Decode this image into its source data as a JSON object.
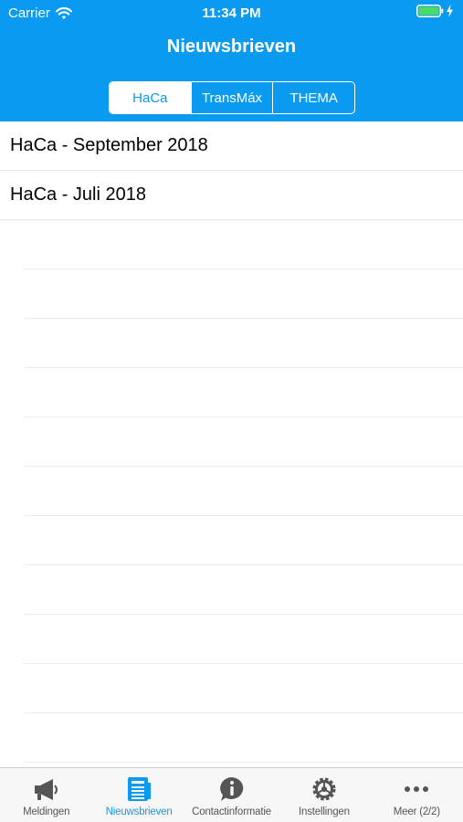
{
  "colors": {
    "accent": "#0a9bf0",
    "tab_inactive": "#555555"
  },
  "status_bar": {
    "carrier": "Carrier",
    "time": "11:34 PM",
    "icons": [
      "wifi-icon",
      "battery-icon",
      "charging-bolt-icon"
    ]
  },
  "nav": {
    "title": "Nieuwsbrieven"
  },
  "segments": [
    {
      "label": "HaCa",
      "selected": true
    },
    {
      "label": "TransMáx",
      "selected": false
    },
    {
      "label": "THEMA",
      "selected": false
    }
  ],
  "list": {
    "items": [
      {
        "title": "HaCa - September 2018"
      },
      {
        "title": "HaCa - Juli 2018"
      }
    ]
  },
  "tab_bar": {
    "tabs": [
      {
        "label": "Meldingen",
        "icon": "megaphone-icon",
        "active": false
      },
      {
        "label": "Nieuwsbrieven",
        "icon": "newspaper-icon",
        "active": true
      },
      {
        "label": "Contactinformatie",
        "icon": "info-bubble-icon",
        "active": false
      },
      {
        "label": "Instellingen",
        "icon": "gear-icon",
        "active": false
      },
      {
        "label": "Meer (2/2)",
        "icon": "more-dots-icon",
        "active": false
      }
    ]
  }
}
